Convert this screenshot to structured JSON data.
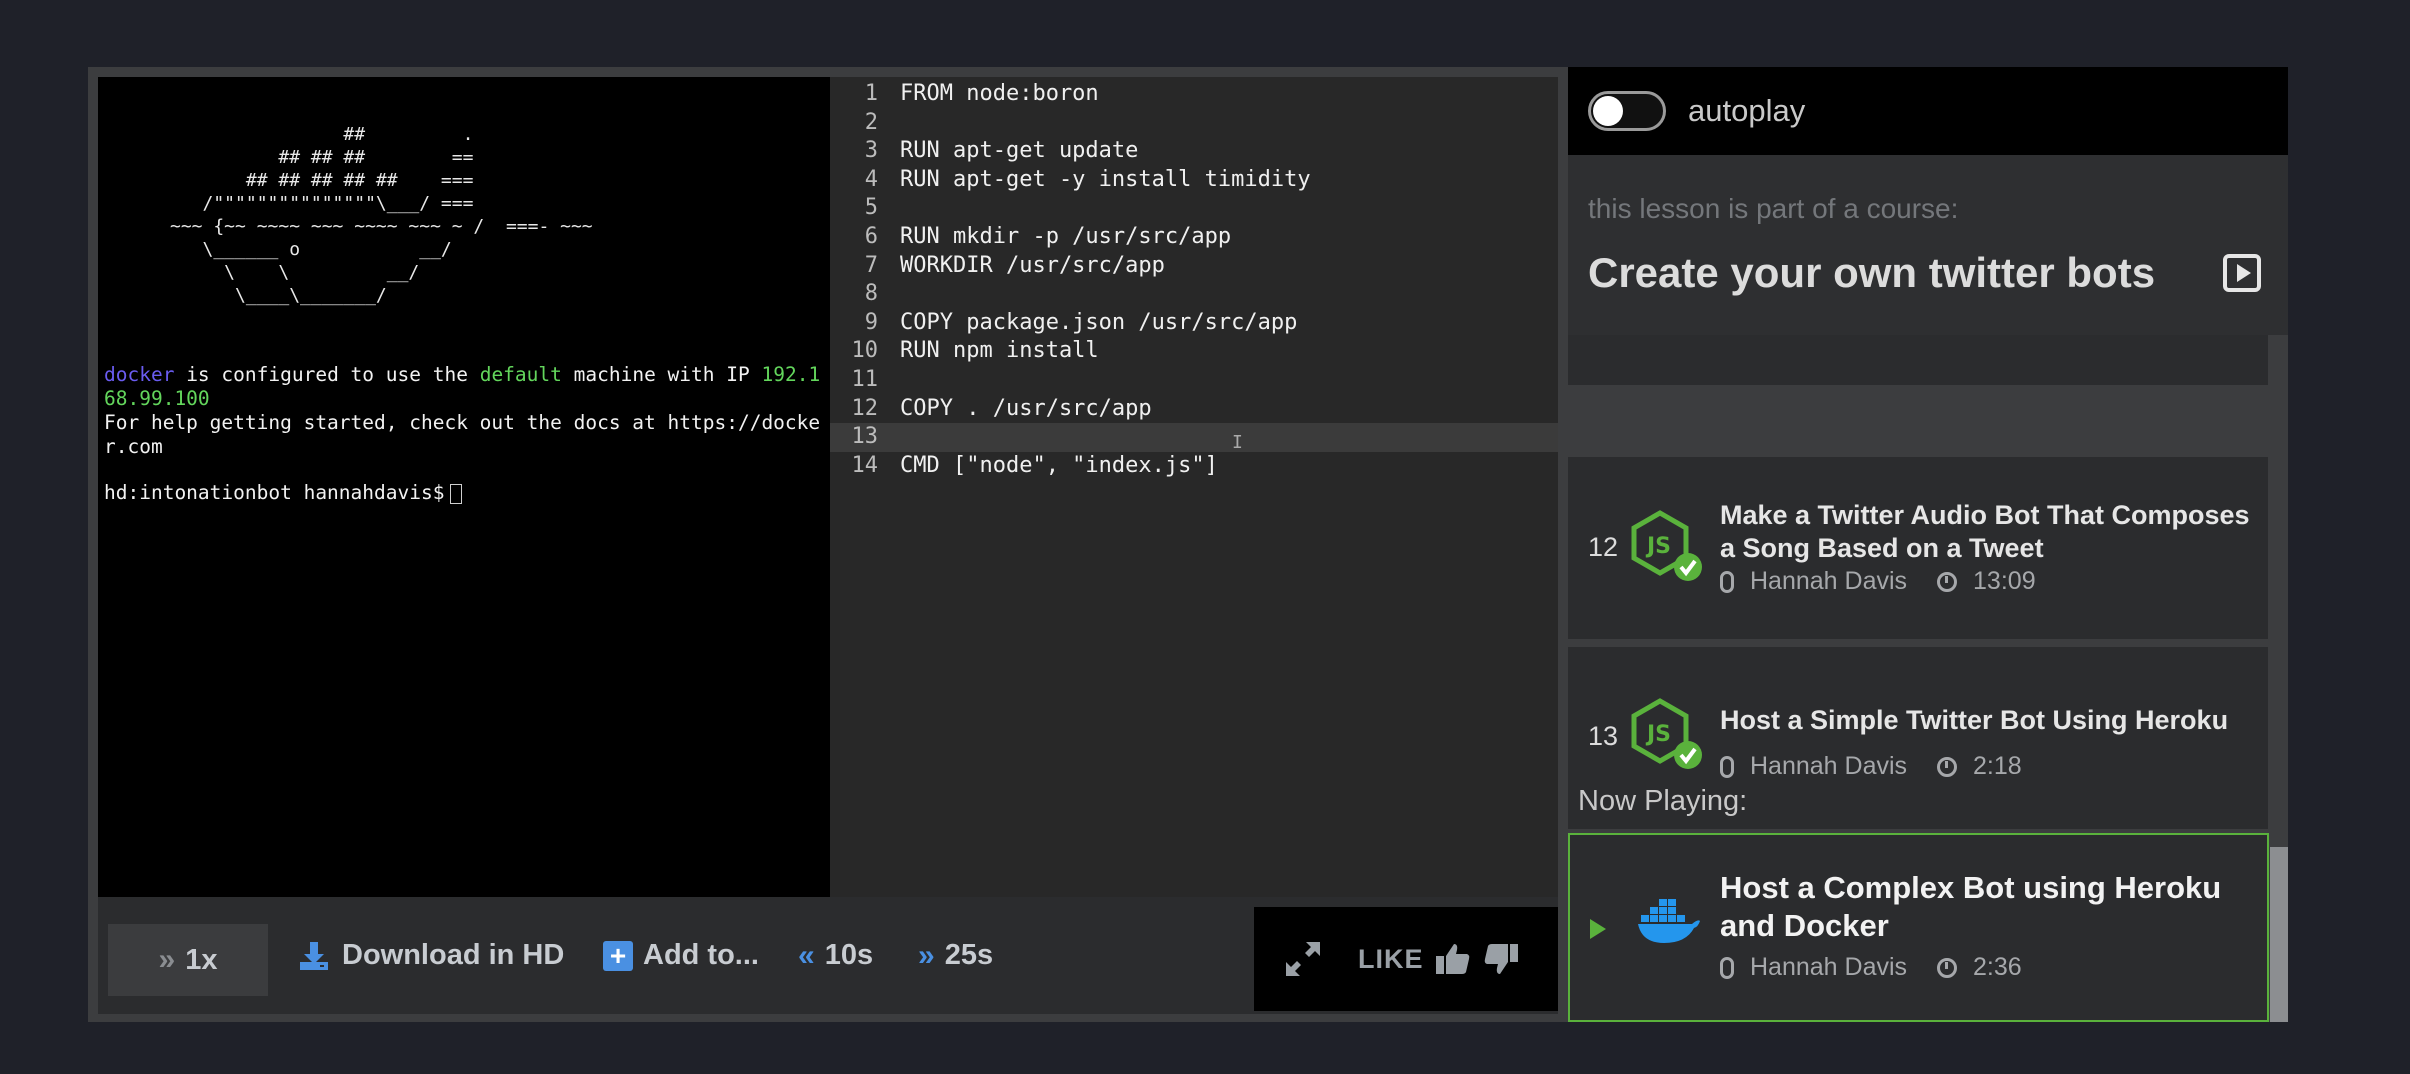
{
  "terminal": {
    "docker_art": "                ##         .\n          ## ## ##        ==\n       ## ## ## ## ##    ===\n   /\"\"\"\"\"\"\"\"\"\"\"\"\"\"\"\\___/ ===\n~~~ {~~ ~~~~ ~~~ ~~~~ ~~~ ~ /  ===- ~~~\n   \\______ o           __/\n     \\    \\         __/\n      \\____\\_______/",
    "line1_word1": "docker",
    "line1_mid": " is configured to use the ",
    "line1_word2": "default",
    "line1_mid2": " machine with IP ",
    "line1_ip": "192.168.99.100",
    "line2": "For help getting started, check out the docs at https://docker.com",
    "prompt": "hd:intonationbot hannahdavis$"
  },
  "editor": {
    "lines": [
      {
        "n": "1",
        "code": "FROM node:boron"
      },
      {
        "n": "2",
        "code": ""
      },
      {
        "n": "3",
        "code": "RUN apt-get update"
      },
      {
        "n": "4",
        "code": "RUN apt-get -y install timidity"
      },
      {
        "n": "5",
        "code": ""
      },
      {
        "n": "6",
        "code": "RUN mkdir -p /usr/src/app"
      },
      {
        "n": "7",
        "code": "WORKDIR /usr/src/app"
      },
      {
        "n": "8",
        "code": ""
      },
      {
        "n": "9",
        "code": "COPY package.json /usr/src/app"
      },
      {
        "n": "10",
        "code": "RUN npm install"
      },
      {
        "n": "11",
        "code": ""
      },
      {
        "n": "12",
        "code": "COPY . /usr/src/app"
      },
      {
        "n": "13",
        "code": ""
      },
      {
        "n": "14",
        "code": "CMD [\"node\", \"index.js\"]"
      }
    ],
    "active_line": "13"
  },
  "controls": {
    "speed": "1x",
    "download": "Download in HD",
    "add_to": "Add to...",
    "back": "10s",
    "forward": "25s",
    "like": "LIKE"
  },
  "sidebar": {
    "autoplay_label": "autoplay",
    "autoplay_on": false,
    "course_sub": "this lesson is part of a course:",
    "course_title": "Create your own twitter bots",
    "lessons": [
      {
        "num": "12",
        "title": "Make a Twitter Audio Bot That Composes a Song Based on a Tweet",
        "author": "Hannah Davis",
        "duration": "13:09"
      },
      {
        "num": "13",
        "title": "Host a Simple Twitter Bot Using Heroku",
        "author": "Hannah Davis",
        "duration": "2:18"
      }
    ],
    "now_playing_label": "Now Playing:",
    "now_playing": {
      "title": "Host a Complex Bot using Heroku and Docker",
      "author": "Hannah Davis",
      "duration": "2:36"
    }
  },
  "colors": {
    "accent_blue": "#4a90e2",
    "node_green": "#5ab23c",
    "docker_blue": "#2496ed"
  }
}
